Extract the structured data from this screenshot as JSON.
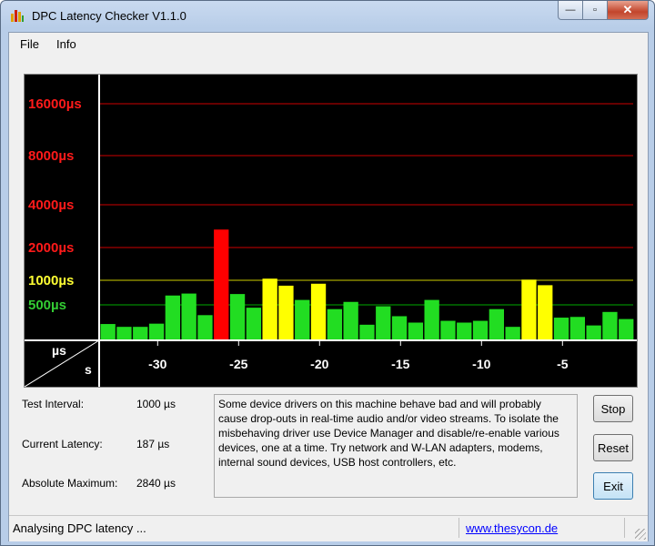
{
  "window": {
    "title": "DPC Latency Checker V1.1.0"
  },
  "menu": {
    "items": [
      "File",
      "Info"
    ]
  },
  "chart_data": {
    "type": "bar",
    "y_tick_labels": [
      {
        "label": "16000µs",
        "color": "#ff1a1a"
      },
      {
        "label": "8000µs",
        "color": "#ff1a1a"
      },
      {
        "label": "4000µs",
        "color": "#ff1a1a"
      },
      {
        "label": "2000µs",
        "color": "#ff1a1a"
      },
      {
        "label": "1000µs",
        "color": "#ffff33"
      },
      {
        "label": "500µs",
        "color": "#33cc33"
      }
    ],
    "x_tick_labels": [
      "-30",
      "-25",
      "-20",
      "-15",
      "-10",
      "-5"
    ],
    "x_values": [
      -33,
      -32,
      -31,
      -30,
      -29,
      -28,
      -27,
      -26,
      -25,
      -24,
      -23,
      -22,
      -21,
      -20,
      -19,
      -18,
      -17,
      -16,
      -15,
      -14,
      -13,
      -12,
      -11,
      -10,
      -9,
      -8,
      -7,
      -6,
      -5,
      -4,
      -3,
      -2,
      -1,
      0
    ],
    "values_us": [
      230,
      190,
      190,
      235,
      690,
      730,
      355,
      2840,
      720,
      460,
      1050,
      890,
      600,
      930,
      440,
      560,
      220,
      480,
      340,
      250,
      600,
      275,
      250,
      275,
      440,
      190,
      1020,
      900,
      320,
      330,
      210,
      400,
      300
    ],
    "axis_unit_labels": {
      "y": "µs",
      "x": "s"
    },
    "colors": {
      "green": "#22dd22",
      "yellow": "#ffff00",
      "red": "#ff0000",
      "background": "#000000"
    }
  },
  "stats": {
    "test_interval": {
      "label": "Test Interval:",
      "value": "1000 µs"
    },
    "current_latency": {
      "label": "Current Latency:",
      "value": "187 µs"
    },
    "absolute_maximum": {
      "label": "Absolute Maximum:",
      "value": "2840 µs"
    }
  },
  "message": "Some device drivers on this machine behave bad and will probably cause drop-outs in real-time audio and/or video streams. To isolate the misbehaving driver use Device Manager and disable/re-enable various devices, one at a time. Try network and W-LAN adapters, modems, internal sound devices, USB host controllers, etc.",
  "buttons": {
    "stop": "Stop",
    "reset": "Reset",
    "exit": "Exit"
  },
  "status": {
    "text": "Analysing DPC latency ...",
    "link": "www.thesycon.de"
  },
  "caption_buttons": {
    "minimize": "—",
    "maximize": "▫",
    "close": "✕"
  }
}
